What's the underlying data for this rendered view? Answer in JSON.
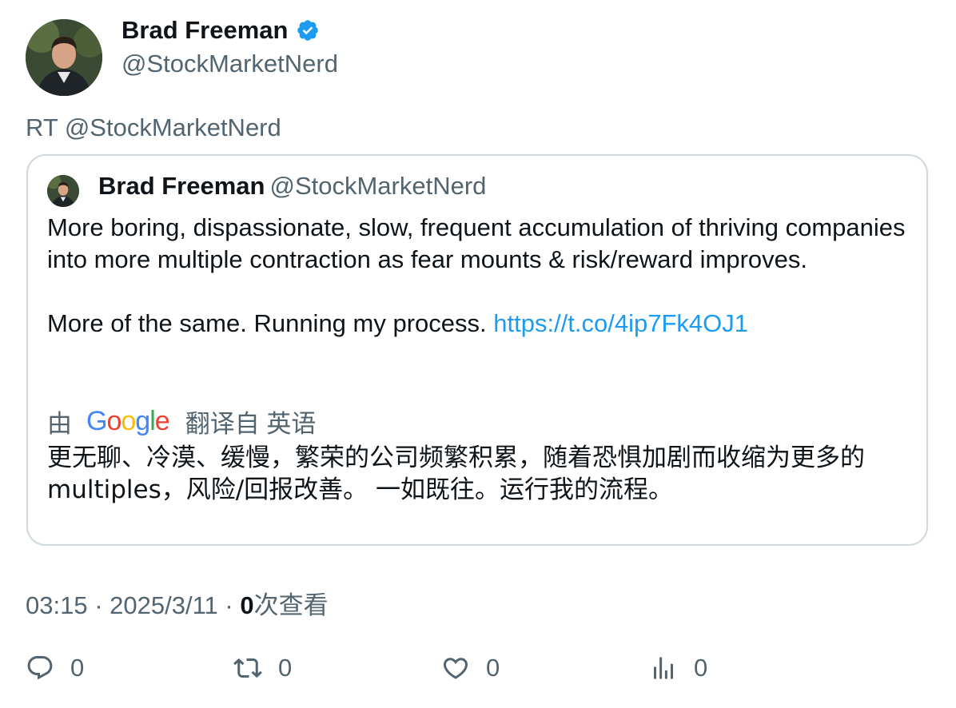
{
  "author": {
    "name": "Brad Freeman",
    "handle": "@StockMarketNerd",
    "verified": true
  },
  "retweet_line": "RT @StockMarketNerd",
  "quoted_tweet": {
    "author_name": "Brad Freeman",
    "author_handle": "@StockMarketNerd",
    "paragraph_1": "More boring, dispassionate, slow, frequent accumulation of thriving companies into more multiple contraction as fear mounts & risk/reward improves.",
    "paragraph_2_text": "More of the same. Running my process. ",
    "paragraph_2_link": "https://t.co/4ip7Fk4OJ1",
    "translation": {
      "prefix": "由",
      "provider_logo_letters": [
        "G",
        "o",
        "o",
        "g",
        "l",
        "e"
      ],
      "suffix": "翻译自 英语",
      "text": "更无聊、冷漠、缓慢，繁荣的公司频繁积累，随着恐惧加剧而收缩为更多的multiples，风险/回报改善。 一如既往。运行我的流程。"
    }
  },
  "meta": {
    "time": "03:15",
    "separator": "·",
    "date": "2025/3/11",
    "views_count": "0",
    "views_label": "次查看"
  },
  "actions": {
    "reply_count": "0",
    "retweet_count": "0",
    "like_count": "0",
    "views_count": "0"
  },
  "colors": {
    "text_primary": "#0f1419",
    "text_secondary": "#536471",
    "link": "#1d9bf0",
    "verified": "#1d9bf0",
    "border": "#cfd9de"
  },
  "icons": [
    "verified-badge-icon",
    "reply-icon",
    "retweet-icon",
    "like-icon",
    "views-icon"
  ]
}
